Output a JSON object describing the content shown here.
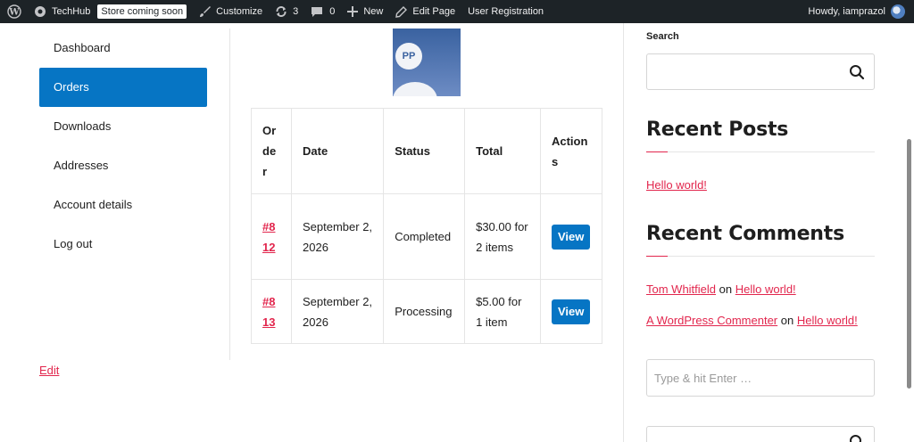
{
  "admin_bar": {
    "site_name": "TechHub",
    "store_badge": "Store coming soon",
    "customize": "Customize",
    "updates_count": "3",
    "comments_count": "0",
    "new": "New",
    "edit_page": "Edit Page",
    "page_label": "User Registration",
    "howdy": "Howdy, iamprazol"
  },
  "account_nav": {
    "items": [
      {
        "label": "Dashboard",
        "active": false
      },
      {
        "label": "Orders",
        "active": true
      },
      {
        "label": "Downloads",
        "active": false
      },
      {
        "label": "Addresses",
        "active": false
      },
      {
        "label": "Account details",
        "active": false
      },
      {
        "label": "Log out",
        "active": false
      }
    ],
    "edit_link": "Edit"
  },
  "profile": {
    "initials": "PP"
  },
  "orders_table": {
    "headers": [
      "Order",
      "Date",
      "Status",
      "Total",
      "Actions"
    ],
    "rows": [
      {
        "order": "#812",
        "date": "September 2, 2026",
        "status": "Completed",
        "total": "$30.00 for 2 items",
        "action": "View"
      },
      {
        "order": "#813",
        "date": "September 2, 2026",
        "status": "Processing",
        "total": "$5.00 for 1 item",
        "action": "View"
      }
    ]
  },
  "sidebar": {
    "search_title": "Search",
    "recent_posts_title": "Recent Posts",
    "recent_posts": [
      "Hello world!"
    ],
    "recent_comments_title": "Recent Comments",
    "recent_comments": [
      {
        "author": "Tom Whitfield",
        "on": "on",
        "post": "Hello world!"
      },
      {
        "author": "A WordPress Commenter",
        "on": "on",
        "post": "Hello world!"
      }
    ],
    "type_placeholder": "Type & hit Enter …"
  },
  "colors": {
    "accent": "#e2264d",
    "primary": "#0675c4",
    "adminbar": "#1d2327"
  }
}
